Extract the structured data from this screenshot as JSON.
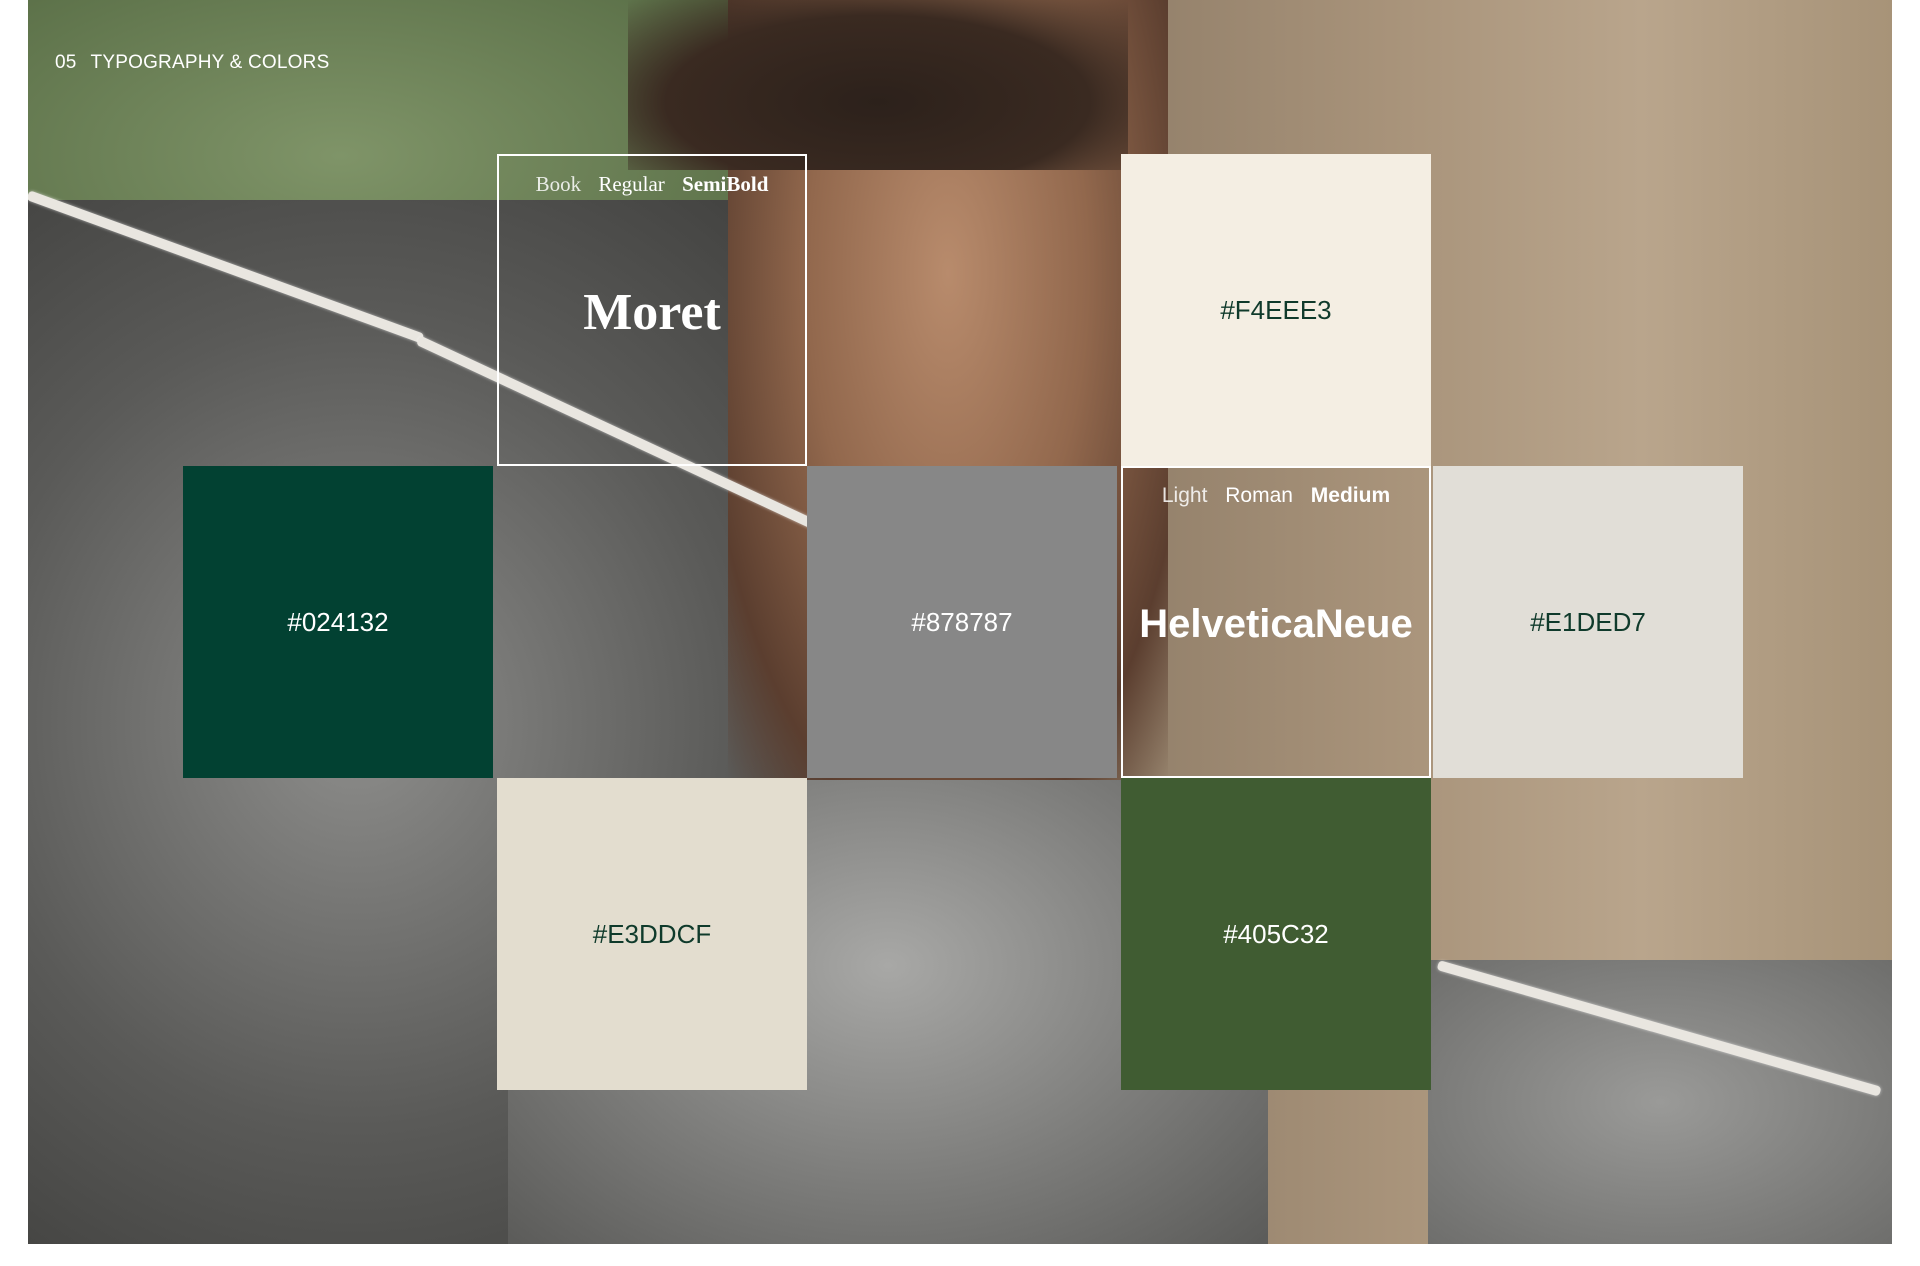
{
  "header": {
    "section_number": "05",
    "section_title": "TYPOGRAPHY & COLORS"
  },
  "typography": {
    "serif": {
      "name": "Moret",
      "weights": [
        "Book",
        "Regular",
        "SemiBold"
      ]
    },
    "sans": {
      "name": "HelveticaNeue",
      "weights": [
        "Light",
        "Roman",
        "Medium"
      ]
    }
  },
  "colors": {
    "cream": "#F4EEE3",
    "dark_green": "#024132",
    "gray": "#878787",
    "light_gray": "#E1DED7",
    "beige": "#E3DDCF",
    "moss_green": "#405C32"
  }
}
